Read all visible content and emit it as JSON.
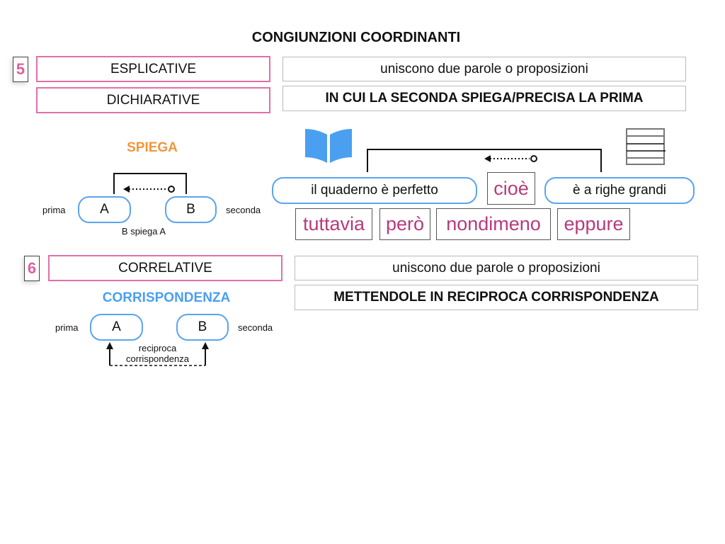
{
  "title": "CONGIUNZIONI COORDINANTI",
  "section5": {
    "number": "5",
    "labels": [
      "ESPLICATIVE",
      "DICHIARATIVE"
    ],
    "definition": "uniscono due parole o proposizioni",
    "definition_bold": "IN CUI LA SECONDA SPIEGA/PRECISA LA PRIMA",
    "diagram": {
      "heading": "SPIEGA",
      "heading_color": "#f0963a",
      "left_label": "prima",
      "right_label": "seconda",
      "box_a": "A",
      "box_b": "B",
      "caption": "B spiega A"
    },
    "example": {
      "icon_left": "open-book-icon",
      "icon_right": "lined-paper-icon",
      "first_clause": "il quaderno è perfetto",
      "conjunction": "cioè",
      "second_clause": "è a righe grandi",
      "other_words": [
        "tuttavia",
        "però",
        "nondimeno",
        "eppure"
      ]
    }
  },
  "section6": {
    "number": "6",
    "label": "CORRELATIVE",
    "definition": "uniscono due parole o proposizioni",
    "definition_bold": "METTENDOLE IN RECIPROCA CORRISPONDENZA",
    "diagram": {
      "heading": "CORRISPONDENZA",
      "heading_color": "#4a9ff0",
      "left_label": "prima",
      "right_label": "seconda",
      "box_a": "A",
      "box_b": "B",
      "caption_line1": "reciproca",
      "caption_line2": "corrispondenza"
    }
  },
  "colors": {
    "pink_accent": "#e070a8",
    "blue_accent": "#5aa4ef",
    "word_color": "#b63a7d"
  }
}
